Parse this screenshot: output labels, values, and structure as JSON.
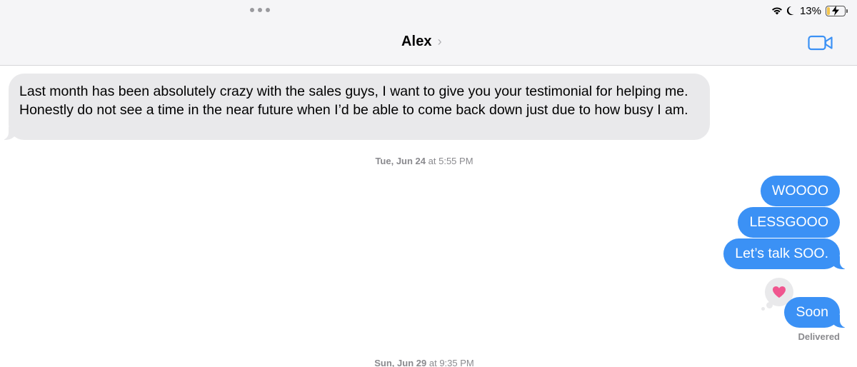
{
  "status_bar": {
    "battery_percent": "13%",
    "battery_level": 0.13,
    "icons": [
      "wifi-icon",
      "moon-icon",
      "battery-charging-icon"
    ]
  },
  "header": {
    "contact_name": "Alex",
    "chevron": "›",
    "video_icon": "video-camera-icon",
    "accent_color": "#3b91f5"
  },
  "messages": {
    "incoming_1": "Last month has been absolutely crazy with the sales guys, I want to give you your testimonial for helping me. Honestly do not see a time in the near future when I’d be able to come back down just due to how busy I am.",
    "timestamp_1_day": "Tue, Jun 24",
    "timestamp_1_at": "at",
    "timestamp_1_time": "5:55 PM",
    "outgoing": [
      "WOOOO",
      "LESSGOOO",
      "Let’s talk SOO.",
      "Soon"
    ],
    "tapback": "heart-icon",
    "delivered": "Delivered",
    "timestamp_2_day": "Sun, Jun 29",
    "timestamp_2_at": "at",
    "timestamp_2_time": "9:35 PM"
  }
}
